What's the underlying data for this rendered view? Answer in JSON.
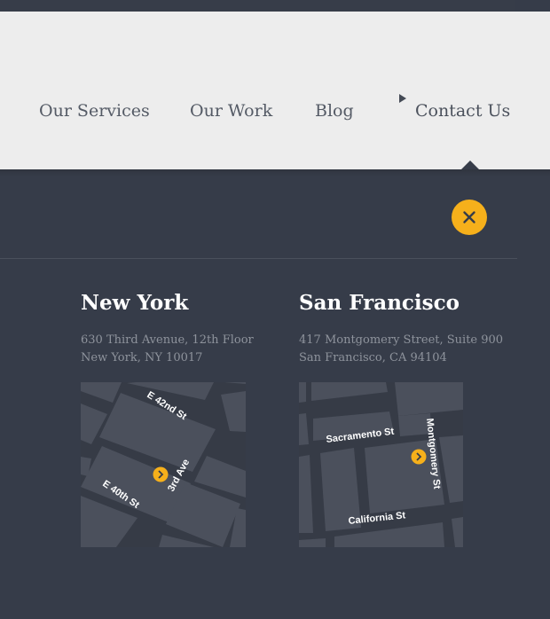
{
  "nav": {
    "items": [
      {
        "label": "Our Services"
      },
      {
        "label": "Our Work"
      },
      {
        "label": "Blog"
      },
      {
        "label": "Contact Us",
        "active": true
      }
    ]
  },
  "close_button": {
    "icon": "close-icon",
    "color": "#f6b01b"
  },
  "offices": [
    {
      "city": "New York",
      "address_line1": "630 Third Avenue, 12th Floor",
      "address_line2": "New York, NY 10017",
      "map": {
        "streets": [
          "E 42nd St",
          "3rd Ave",
          "E 40th St"
        ],
        "marker_icon": "map-pin-icon"
      }
    },
    {
      "city": "San Francisco",
      "address_line1": "417 Montgomery Street, Suite 900",
      "address_line2": "San Francisco, CA 94104",
      "map": {
        "streets": [
          "Sacramento St",
          "Montgomery St",
          "California St"
        ],
        "marker_icon": "map-pin-icon"
      }
    }
  ],
  "colors": {
    "header_bg": "#ededed",
    "panel_bg": "#363c49",
    "accent": "#f6b01b",
    "map_bg": "#4b505c",
    "map_street": "#363b46"
  }
}
